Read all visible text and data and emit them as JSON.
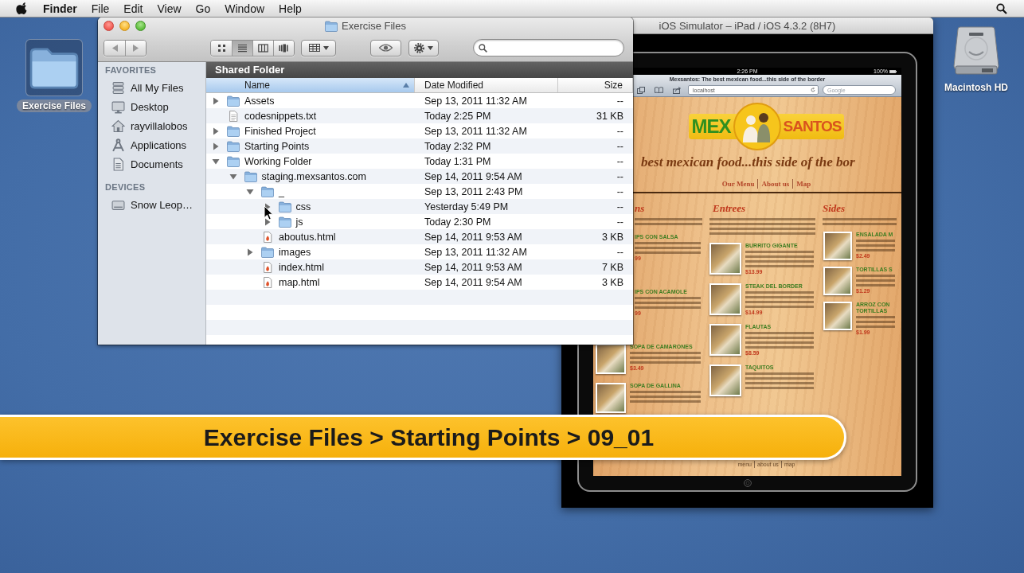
{
  "menu_bar": {
    "app": "Finder",
    "items": [
      "File",
      "Edit",
      "View",
      "Go",
      "Window",
      "Help"
    ]
  },
  "desktop_icons": [
    {
      "label": "Exercise Files",
      "kind": "folder",
      "selected": true
    },
    {
      "label": "Macintosh HD",
      "kind": "drive",
      "selected": false
    }
  ],
  "finder": {
    "title": "Exercise Files",
    "views": [
      {
        "kind": "icons",
        "selected": false
      },
      {
        "kind": "list",
        "selected": true
      },
      {
        "kind": "columns",
        "selected": false
      },
      {
        "kind": "cover-flow",
        "selected": false
      }
    ],
    "sidebar": [
      {
        "heading": "FAVORITES",
        "items": [
          {
            "label": "All My Files",
            "kind": "all-files",
            "selected": false
          },
          {
            "label": "Desktop",
            "kind": "desktop",
            "selected": false
          },
          {
            "label": "rayvillalobos",
            "kind": "home",
            "selected": false
          },
          {
            "label": "Applications",
            "kind": "applications",
            "selected": false
          },
          {
            "label": "Documents",
            "kind": "documents",
            "selected": false
          }
        ]
      },
      {
        "heading": "DEVICES",
        "items": [
          {
            "label": "Snow Leop…",
            "kind": "disk",
            "selected": false
          }
        ]
      }
    ],
    "folder_header": "Shared Folder",
    "columns": [
      {
        "label": "Name",
        "selected": true
      },
      {
        "label": "Date Modified",
        "selected": false
      },
      {
        "label": "Size",
        "selected": false
      }
    ],
    "files": [
      {
        "name": "Assets",
        "kind": "folder",
        "expanded": false,
        "date": "Sep 13, 2011 11:32 AM",
        "size": "--"
      },
      {
        "name": "codesnippets.txt",
        "kind": "text-file",
        "date": "Today 2:25 PM",
        "size": "31 KB"
      },
      {
        "name": "Finished Project",
        "kind": "folder",
        "expanded": false,
        "date": "Sep 13, 2011 11:32 AM",
        "size": "--"
      },
      {
        "name": "Starting Points",
        "kind": "folder",
        "expanded": false,
        "date": "Today 2:32 PM",
        "size": "--"
      },
      {
        "name": "Working Folder",
        "kind": "folder",
        "expanded": true,
        "date": "Today 1:31 PM",
        "size": "--",
        "children": [
          {
            "name": "staging.mexsantos.com",
            "kind": "folder",
            "expanded": true,
            "date": "Sep 14, 2011 9:54 AM",
            "size": "--",
            "children": [
              {
                "name": "_",
                "kind": "folder",
                "expanded": true,
                "date": "Sep 13, 2011 2:43 PM",
                "size": "--",
                "children": [
                  {
                    "name": "css",
                    "kind": "folder",
                    "expanded": false,
                    "date": "Yesterday 5:49 PM",
                    "size": "--"
                  },
                  {
                    "name": "js",
                    "kind": "folder",
                    "expanded": false,
                    "date": "Today 2:30 PM",
                    "size": "--"
                  }
                ]
              },
              {
                "name": "aboutus.html",
                "kind": "html-file",
                "date": "Sep 14, 2011 9:53 AM",
                "size": "3 KB"
              },
              {
                "name": "images",
                "kind": "folder",
                "expanded": false,
                "date": "Sep 13, 2011 11:32 AM",
                "size": "--"
              },
              {
                "name": "index.html",
                "kind": "html-file",
                "date": "Sep 14, 2011 9:53 AM",
                "size": "7 KB"
              },
              {
                "name": "map.html",
                "kind": "html-file",
                "date": "Sep 14, 2011 9:54 AM",
                "size": "3 KB"
              }
            ]
          }
        ]
      }
    ]
  },
  "simulator": {
    "title": "iOS Simulator – iPad / iOS 4.3.2 (8H7)",
    "status_bar": {
      "time": "2:26 PM",
      "battery": "100%"
    },
    "browser": {
      "page_title": "Mexsantos: The best mexican food...this side of the border",
      "url": "localhost",
      "search_placeholder": "Google"
    },
    "page": {
      "logo": [
        "MEX",
        "SANTOS"
      ],
      "tagline": "best mexican food...this side of the bor",
      "nav": [
        "Our Menu",
        "About us",
        "Map"
      ],
      "menu_columns": [
        {
          "heading": "ns",
          "items": [
            {
              "name": "IPS CON SALSA",
              "price": "99",
              "photo": false
            },
            {
              "name": "IPS CON ACAMOLE",
              "price": "99",
              "photo": false
            },
            {
              "name": "SOPA DE CAMARONES",
              "price": "$3.49",
              "photo": true
            },
            {
              "name": "SOPA DE GALLINA",
              "photo": true
            }
          ]
        },
        {
          "heading": "Entrees",
          "items": [
            {
              "name": "BURRITO GIGANTE",
              "price": "$13.99",
              "photo": true
            },
            {
              "name": "STEAK DEL BORDER",
              "price": "$14.99",
              "photo": true
            },
            {
              "name": "FLAUTAS",
              "price": "$8.59",
              "photo": true
            },
            {
              "name": "TAQUITOS",
              "photo": true
            }
          ]
        },
        {
          "heading": "Sides",
          "items": [
            {
              "name": "ENSALADA M",
              "price": "$2.49",
              "photo": true
            },
            {
              "name": "TORTILLAS S",
              "price": "$1.29",
              "photo": true
            },
            {
              "name": "ARROZ CON TORTILLAS",
              "price": "$1.99",
              "photo": true
            }
          ]
        }
      ],
      "footer": [
        "menu",
        "about us",
        "map"
      ]
    }
  },
  "banner": "Exercise Files > Starting Points > 09_01"
}
